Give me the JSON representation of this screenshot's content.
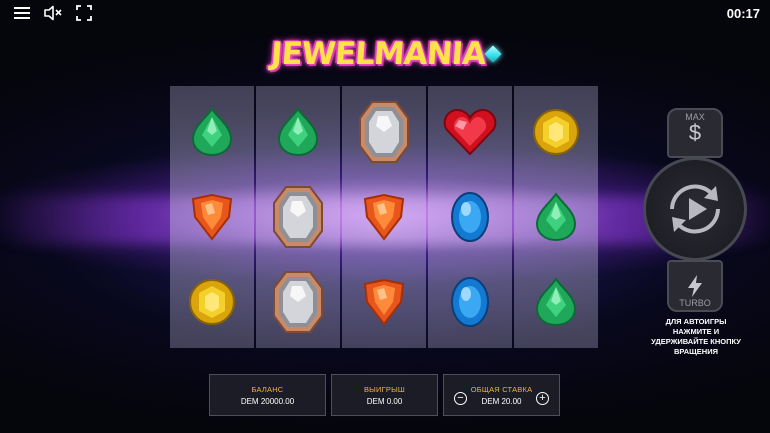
{
  "top_bar": {
    "menu_icon": "hamburger-menu-icon",
    "sound_icon": "speaker-muted-icon",
    "fullscreen_icon": "fullscreen-icon",
    "clock": "00:17"
  },
  "logo": {
    "text": "JEWELMANIA"
  },
  "reels": [
    [
      "emerald",
      "orange-shield",
      "yellow-topaz"
    ],
    [
      "emerald",
      "silver-diamond",
      "silver-diamond"
    ],
    [
      "silver-diamond",
      "orange-shield",
      "orange-shield"
    ],
    [
      "ruby-heart",
      "blue-sapphire",
      "blue-sapphire"
    ],
    [
      "yellow-topaz",
      "emerald",
      "emerald"
    ]
  ],
  "controls": {
    "max_bet_label": "MAX",
    "max_bet_icon": "$",
    "turbo_label": "TURBO",
    "autoplay_hint": "ДЛЯ АВТОИГРЫ НАЖМИТЕ И УДЕРЖИВАЙТЕ КНОПКУ ВРАЩЕНИЯ"
  },
  "panel": {
    "balance_label": "БАЛАНС",
    "balance_value": "DEM 20000.00",
    "win_label": "ВЫИГРЫШ",
    "win_value": "DEM 0.00",
    "bet_label": "ОБЩАЯ СТАВКА",
    "bet_value": "DEM 20.00",
    "minus": "−",
    "plus": "+"
  },
  "colors": {
    "panel_label": "#f0b43a",
    "logo": "#ffe14a",
    "logo_glow": "#ff4fd8"
  }
}
